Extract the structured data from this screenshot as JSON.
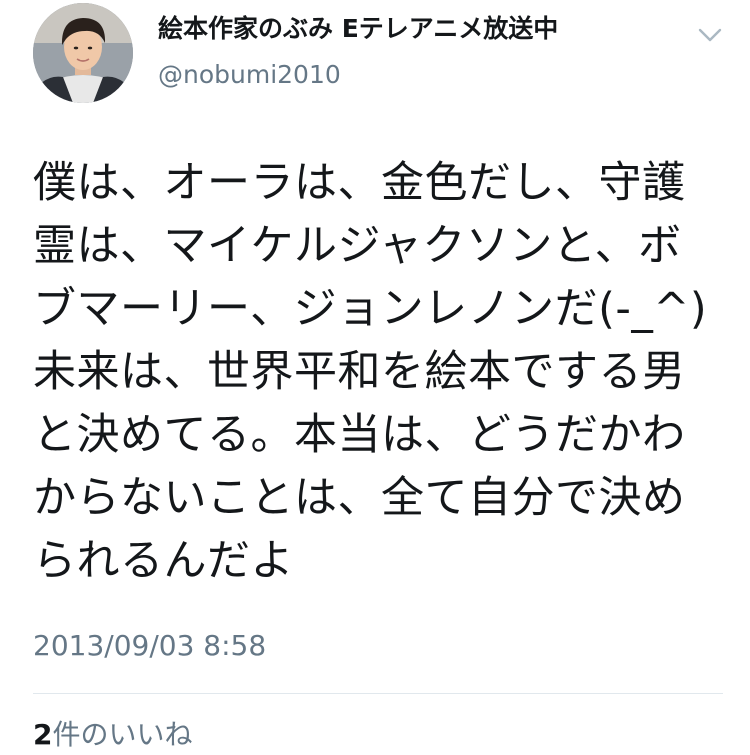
{
  "author": {
    "display_name": "絵本作家のぶみ Eテレアニメ放送中",
    "handle": "@nobumi2010",
    "avatar_icon": "profile-photo"
  },
  "menu": {
    "icon": "chevron-down-icon"
  },
  "tweet": {
    "text": "僕は、オーラは、金色だし、守護霊は、マイケルジャクソンと、ボブマーリー、ジョンレノンだ(-_^)未来は、世界平和を絵本でする男と決めてる。本当は、どうだかわからないことは、全て自分で決められるんだよ",
    "timestamp": "2013/09/03 8:58"
  },
  "stats": {
    "likes_count": "2",
    "likes_label": "件のいいね"
  },
  "colors": {
    "text": "#14171a",
    "secondary": "#657786",
    "divider": "#e1e8ed"
  }
}
